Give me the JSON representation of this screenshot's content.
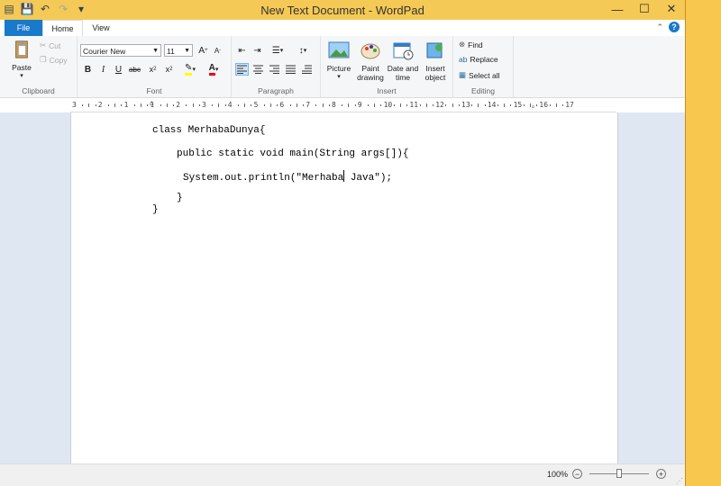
{
  "window": {
    "title": "New Text Document - WordPad"
  },
  "title_controls": {
    "minimize": "—",
    "maximize": "☐",
    "close": "✕"
  },
  "tabs": [
    {
      "label": "File"
    },
    {
      "label": "Home"
    },
    {
      "label": "View"
    }
  ],
  "ribbon": {
    "clipboard": {
      "label": "Clipboard",
      "paste": "Paste",
      "cut": "Cut",
      "copy": "Copy"
    },
    "font": {
      "label": "Font",
      "font_name": "Courier New",
      "font_size": "11"
    },
    "paragraph": {
      "label": "Paragraph"
    },
    "insert": {
      "label": "Insert",
      "picture": "Picture",
      "paint_drawing_1": "Paint",
      "paint_drawing_2": "drawing",
      "date_time_1": "Date and",
      "date_time_2": "time",
      "insert_object_1": "Insert",
      "insert_object_2": "object"
    },
    "editing": {
      "label": "Editing",
      "find": "Find",
      "replace": "Replace",
      "select_all": "Select all"
    }
  },
  "ruler": {
    "numbers": [
      "3",
      "2",
      "1",
      "1",
      "2",
      "3",
      "4",
      "5",
      "6",
      "7",
      "8",
      "9",
      "10",
      "11",
      "12",
      "13",
      "14",
      "15",
      "16",
      "17"
    ]
  },
  "document": {
    "lines": [
      "class MerhabaDunya{",
      "public static void main(String args[]){",
      "System.out.println(\"Merhaba",
      " Java\");",
      "}",
      "}"
    ]
  },
  "status": {
    "zoom": "100%",
    "zoom_level_percent": 100
  }
}
